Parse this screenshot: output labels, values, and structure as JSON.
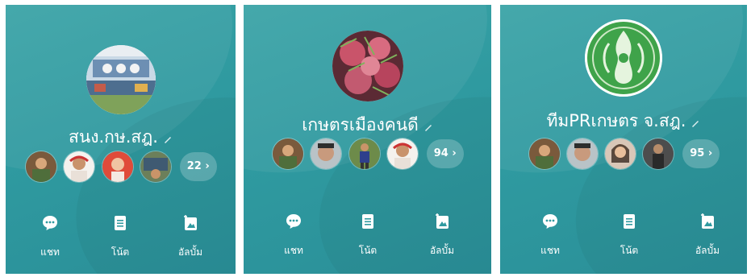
{
  "panels": [
    {
      "group_name": "สนง.กษ.สฎ.",
      "member_count": "22",
      "actions": {
        "chat": "แชท",
        "note": "โน้ต",
        "album": "อัลบั้ม"
      },
      "chevron": "›"
    },
    {
      "group_name": "เกษตรเมืองคนดี",
      "member_count": "94",
      "actions": {
        "chat": "แชท",
        "note": "โน้ต",
        "album": "อัลบั้ม"
      },
      "chevron": "›"
    },
    {
      "group_name": "ทีมPRเกษตร จ.สฎ.",
      "member_count": "95",
      "actions": {
        "chat": "แชท",
        "note": "โน้ต",
        "album": "อัลบั้ม"
      },
      "chevron": "›"
    }
  ],
  "icons": {
    "chat": "chat-bubble-icon",
    "note": "note-icon",
    "album": "album-icon",
    "edit": "pencil-icon"
  },
  "colors": {
    "panel_bg": "#2f9aa0",
    "text": "#ffffff"
  }
}
